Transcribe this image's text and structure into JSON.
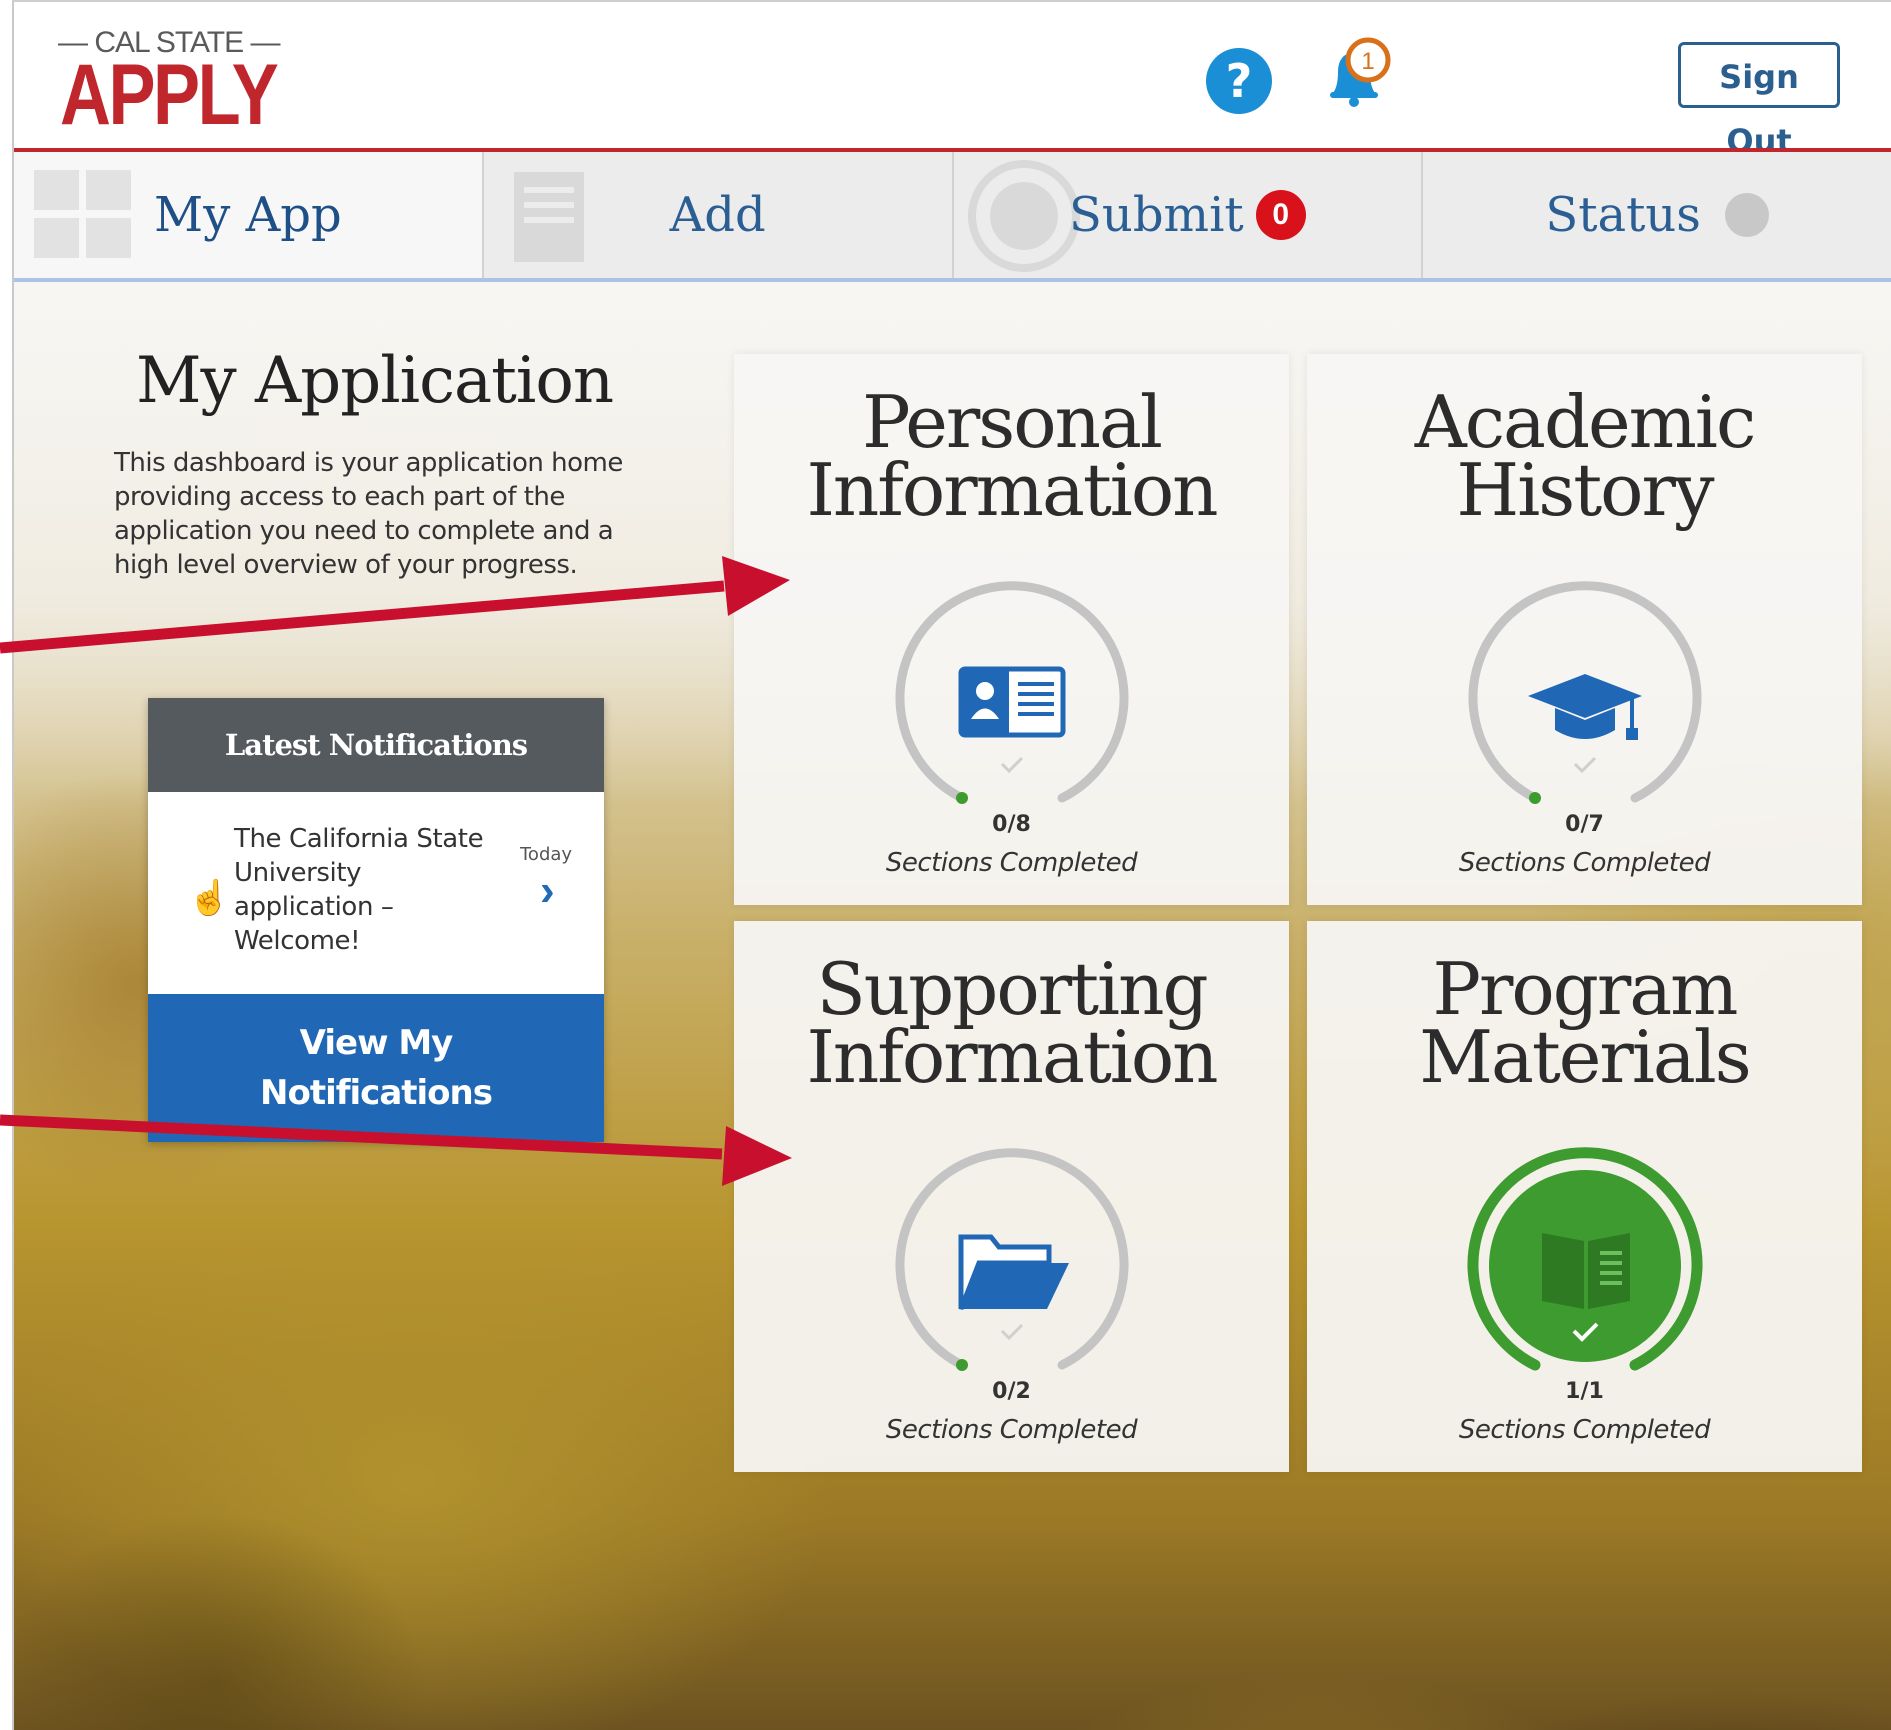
{
  "header": {
    "logo_top": "— CAL STATE —",
    "logo_main": "APPLY",
    "help_icon": "?",
    "notification_count": "1",
    "signout_label": "Sign Out"
  },
  "tabs": [
    {
      "label": "My App",
      "icon": "grid-icon"
    },
    {
      "label": "Add",
      "icon": "document-icon"
    },
    {
      "label": "Submit",
      "badge": "0",
      "icon": "seal-icon"
    },
    {
      "label": "Status",
      "icon": "check-circle-icon"
    }
  ],
  "intro": {
    "title": "My Application",
    "text": "This dashboard is your application home providing access to each part of the application you need to complete and a high level overview of your progress."
  },
  "notifications": {
    "header": "Latest Notifications",
    "item_text": "The California State University application – Welcome!",
    "item_time": "Today",
    "button_line1": "View My",
    "button_line2": "Notifications"
  },
  "cards": [
    {
      "title_line1": "Personal",
      "title_line2": "Information",
      "count": "0/8",
      "subtitle": "Sections Completed",
      "completed": 0,
      "total": 8,
      "icon": "id-card-icon"
    },
    {
      "title_line1": "Academic",
      "title_line2": "History",
      "count": "0/7",
      "subtitle": "Sections Completed",
      "completed": 0,
      "total": 7,
      "icon": "graduation-cap-icon"
    },
    {
      "title_line1": "Supporting",
      "title_line2": "Information",
      "count": "0/2",
      "subtitle": "Sections Completed",
      "completed": 0,
      "total": 2,
      "icon": "folder-icon"
    },
    {
      "title_line1": "Program",
      "title_line2": "Materials",
      "count": "1/1",
      "subtitle": "Sections Completed",
      "completed": 1,
      "total": 1,
      "icon": "book-icon"
    }
  ],
  "colors": {
    "brand_red": "#c0272d",
    "link_blue": "#2068b5",
    "complete_green": "#3e9b2f",
    "annotation_arrow": "#c8102e"
  }
}
